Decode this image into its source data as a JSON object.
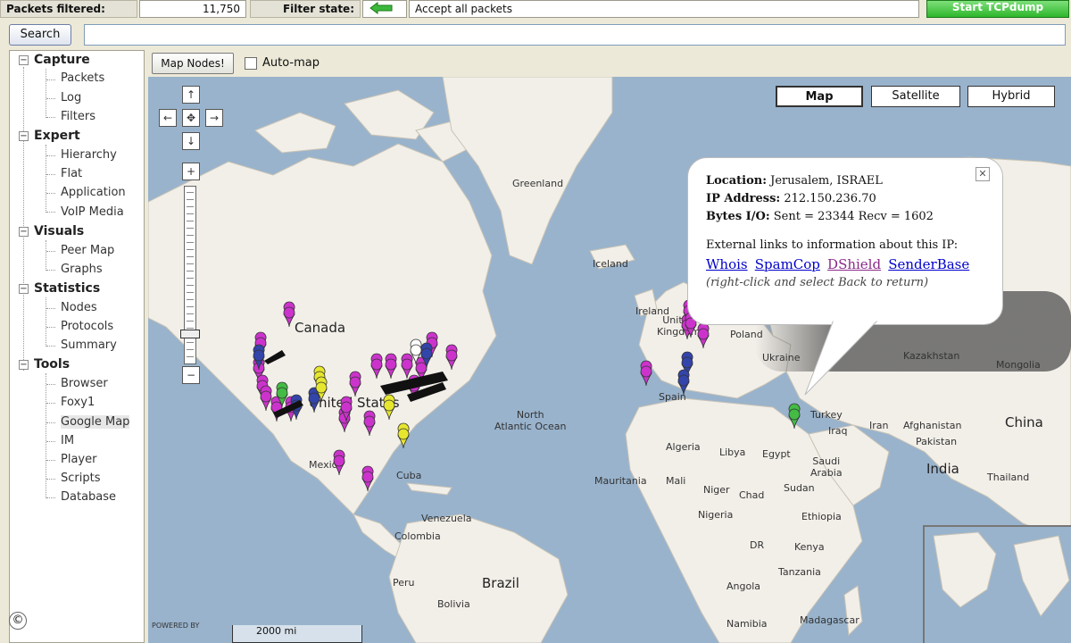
{
  "status": {
    "packets_filtered_label": "Packets filtered:",
    "packets_filtered_value": "11,750",
    "filter_state_label": "Filter state:",
    "filter_state_icon": "green-arrow-icon",
    "filter_state_value": "Accept all packets",
    "start_button_label": "Start TCPdump"
  },
  "search": {
    "button_label": "Search",
    "value": ""
  },
  "sidebar": {
    "groups": [
      {
        "label": "Capture",
        "items": [
          "Packets",
          "Log",
          "Filters"
        ]
      },
      {
        "label": "Expert",
        "items": [
          "Hierarchy",
          "Flat",
          "Application",
          "VoIP Media"
        ]
      },
      {
        "label": "Visuals",
        "items": [
          "Peer Map",
          "Graphs"
        ]
      },
      {
        "label": "Statistics",
        "items": [
          "Nodes",
          "Protocols",
          "Summary"
        ]
      },
      {
        "label": "Tools",
        "items": [
          "Browser",
          "Foxy1",
          "Google Map",
          "IM",
          "Player",
          "Scripts",
          "Database"
        ]
      }
    ],
    "selected": "Google Map"
  },
  "map_toolbar": {
    "map_nodes_label": "Map Nodes!",
    "auto_map_label": "Auto-map",
    "auto_map_checked": false
  },
  "map": {
    "types": [
      "Map",
      "Satellite",
      "Hybrid"
    ],
    "active_type": "Map",
    "nav": {
      "up": "↑",
      "left": "←",
      "center": "✥",
      "right": "→",
      "down": "↓",
      "zoom_in": "+",
      "zoom_out": "−"
    },
    "labels": {
      "greenland": "Greenland",
      "canada": "Canada",
      "united_states": "United States",
      "north_atlantic": "North\nAtlantic Ocean",
      "iceland": "Iceland",
      "poland": "Poland",
      "ukraine": "Ukraine",
      "kazakhstan": "Kazakhstan",
      "mongolia": "Mongolia",
      "turkey": "Turkey",
      "iraq": "Iraq",
      "iran": "Iran",
      "afghanistan": "Afghanistan",
      "pakistan": "Pakistan",
      "china": "China",
      "india": "India",
      "algeria": "Algeria",
      "libya": "Libya",
      "egypt": "Egypt",
      "saudi_arabia": "Saudi\nArabia",
      "mali": "Mali",
      "niger": "Niger",
      "chad": "Chad",
      "sudan": "Sudan",
      "mauritania": "Mauritania",
      "nigeria": "Nigeria",
      "ethiopia": "Ethiopia",
      "dr": "DR",
      "kenya": "Kenya",
      "tanzania": "Tanzania",
      "angola": "Angola",
      "namibia": "Namibia",
      "madagascar": "Madagascar",
      "mexico": "Mexico",
      "cuba": "Cuba",
      "venezuela": "Venezuela",
      "colombia": "Colombia",
      "peru": "Peru",
      "bolivia": "Bolivia",
      "brazil": "Brazil",
      "spain": "Spain",
      "thailand": "Thailand",
      "ireland": "Ireland",
      "united_kingdom": "United\nKingdom"
    },
    "scale_label": "2000 mi",
    "powered_by": "POWERED BY"
  },
  "info_window": {
    "location_label": "Location:",
    "location_value": "Jerusalem, ISRAEL",
    "ip_label": "IP Address:",
    "ip_value": "212.150.236.70",
    "bytes_label": "Bytes I/O:",
    "bytes_value": "Sent = 23344 Recv = 1602",
    "links_intro": "External links to information about this IP:",
    "links": [
      "Whois",
      "SpamCop",
      "DShield",
      "SenderBase"
    ],
    "note": "(right-click and select Back to return)"
  },
  "copyright_symbol": "©",
  "colors": {
    "water": "#99b3cc",
    "land": "#f2efe9",
    "pin_magenta": "#cc33cc",
    "pin_blue": "#3344aa",
    "pin_yellow": "#e6e62e",
    "pin_green": "#44bb44"
  }
}
